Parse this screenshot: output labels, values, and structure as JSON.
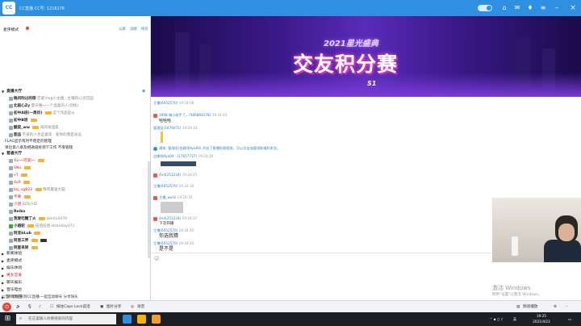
{
  "window": {
    "title": "CC直播  CC号: 1216176"
  },
  "left": {
    "mode_label": "麦序模式",
    "tabs": [
      "公屏",
      "贡献",
      "排名"
    ],
    "room_title": "直播大厅",
    "top_list": [
      {
        "name": "晚风吹过的街",
        "note": "恋爱Vlog小主播 · 主播的心灵花园"
      },
      {
        "name": "北极心Zy",
        "note": "夏天唯一一个温柔的人(勿扰)"
      },
      {
        "name": "初中A班(一周目)",
        "note": "这个作品是ai"
      },
      {
        "name": "初中B班",
        "note": ""
      },
      {
        "name": "酸菜_ww",
        "note": "海风很温柔"
      },
      {
        "name": "甜品",
        "note": "不爱的人也是喜欢 · 爱你的我是永远"
      }
    ],
    "notices": [
      "FLAG显示有时不稳定的管理",
      "单位第八章及相通道统领下工作  不受管辖"
    ],
    "sec_main": "普通大厅",
    "members": [
      {
        "name": "Yui~(可爱)~",
        "note": ""
      },
      {
        "name": "SNo",
        "note": ""
      },
      {
        "name": "xT",
        "note": ""
      },
      {
        "name": "4xR",
        "note": ""
      },
      {
        "name": "bsj_sgB22",
        "note": "我有最强大脑"
      },
      {
        "name": "不要",
        "note": ""
      },
      {
        "name": "小团",
        "note": "白马小白"
      },
      {
        "name": "Reiko",
        "note": ""
      },
      {
        "name": "我爱吃糖丁火",
        "note": "akinhi4479"
      },
      {
        "name": "小骆驼",
        "note": "伍佰伍佰·stranday071"
      },
      {
        "name": "阿亚bLub",
        "note": ""
      },
      {
        "name": "阿里三界",
        "note": ""
      },
      {
        "name": "阿星来同",
        "note": ""
      }
    ],
    "groups": [
      "新闻体验",
      "麦序模式",
      "娱乐休闲",
      "男女恋爱",
      "聊天娱乐",
      "音乐电台",
      "游戏专区"
    ],
    "bottom_notice": "公告：欢迎来到CC直播·一起互动聊天 分享快乐"
  },
  "banner": {
    "subtitle": "2021星光盛典",
    "title": "交友积分赛",
    "tag": "S1"
  },
  "chat": {
    "lines": [
      {
        "user": "主播(6052570)",
        "time": "19:24:06",
        "msg": "",
        "kind": "plain"
      },
      {
        "user": "1998 嗨小助手了。(586868178)",
        "time": "19:24:15",
        "msg": "哈哈哈",
        "kind": "gift"
      },
      {
        "user": "管理员(1676972)",
        "time": "19:24:16",
        "msg": "",
        "kind": "plain"
      },
      {
        "user": "通知:",
        "time": "",
        "msg": "有管理员 ..."
      }
    ],
    "list": [
      {
        "user": "主播(6052570)",
        "time": "19:24:06",
        "msg": "",
        "icon": "none"
      },
      {
        "user": "1998 嗨小助手了。(586868178)",
        "time": "19:24:15",
        "msg": "哈哈哈",
        "icon": "gift"
      },
      {
        "user": "管理员(1676972)",
        "time": "19:24:16",
        "msg": "",
        "icon": "none"
      },
      {
        "user": "通知",
        "time": "",
        "msg": "管理员(白嫖领Aya94) 开启了直播权限权限，可以点击加速领取福利发言。",
        "icon": "info"
      },
      {
        "user": "白嫖领Aya94 · (17657737)",
        "time": "19:24:20",
        "msg": "",
        "icon": "none"
      },
      {
        "user": "4nd(251234)",
        "time": "19:24:25",
        "msg": "",
        "icon": "gift"
      },
      {
        "user": "主播(6052570)",
        "time": "19:24:32",
        "msg": "",
        "icon": "none"
      },
      {
        "user": "主播_wuliii",
        "time": "19:24:35",
        "msg": "",
        "icon": "gift"
      },
      {
        "user": "4nd(251234)",
        "time": "19:24:37",
        "msg": "下次开播",
        "icon": "gift"
      },
      {
        "user": "主播(6052570)",
        "time": "19:24:40",
        "msg": "你选我猜",
        "icon": "none"
      },
      {
        "user": "主播(6052570)",
        "time": "19:24:42",
        "msg": "是不是",
        "icon": "none"
      }
    ]
  },
  "watermark": {
    "line1": "激活 Windows",
    "line2": "转到\"设置\"以激活 Windows。"
  },
  "toolbar": {
    "mic_hint": "按住Caps Lock说话",
    "mode_label": "图片分享",
    "mute_label": "语音",
    "right_label": "频道播放"
  },
  "taskbar": {
    "search_placeholder": "在这里输入你要搜索的内容",
    "time": "19:25",
    "date": "2021/4/23",
    "lang": "英"
  }
}
